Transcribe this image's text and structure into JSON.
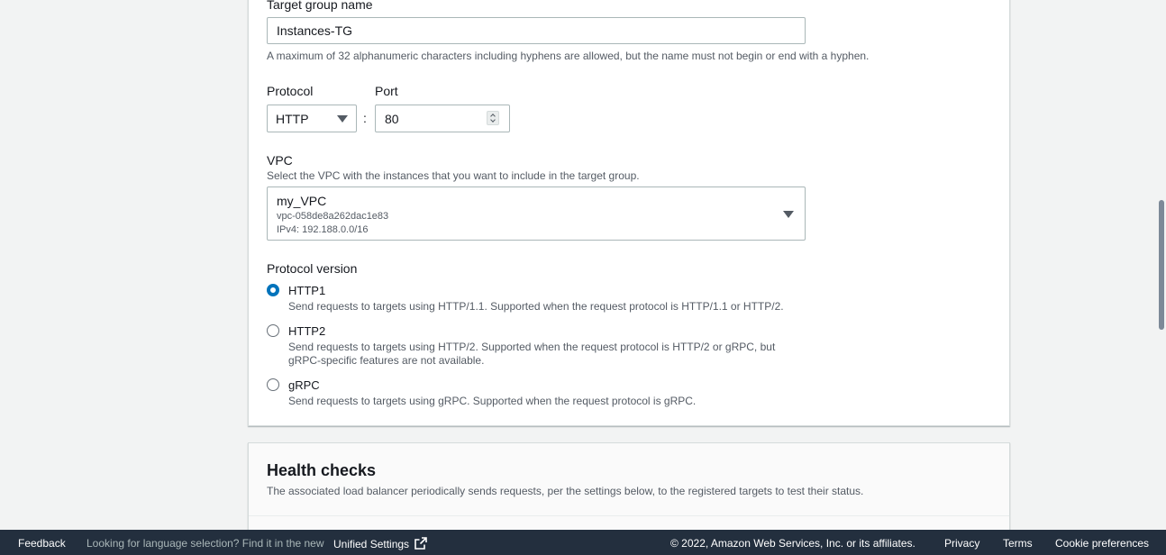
{
  "target_group": {
    "label": "Target group name",
    "value": "Instances-TG",
    "hint": "A maximum of 32 alphanumeric characters including hyphens are allowed, but the name must not begin or end with a hyphen."
  },
  "protocol": {
    "label": "Protocol",
    "value": "HTTP"
  },
  "separator": ":",
  "port": {
    "label": "Port",
    "value": "80"
  },
  "vpc": {
    "label": "VPC",
    "hint": "Select the VPC with the instances that you want to include in the target group.",
    "name": "my_VPC",
    "id": "vpc-058de8a262dac1e83",
    "cidr": "IPv4: 192.188.0.0/16"
  },
  "protocol_version": {
    "label": "Protocol version",
    "selected": "HTTP1",
    "options": [
      {
        "label": "HTTP1",
        "desc": "Send requests to targets using HTTP/1.1. Supported when the request protocol is HTTP/1.1 or HTTP/2."
      },
      {
        "label": "HTTP2",
        "desc": "Send requests to targets using HTTP/2. Supported when the request protocol is HTTP/2 or gRPC, but gRPC-specific features are not available."
      },
      {
        "label": "gRPC",
        "desc": "Send requests to targets using gRPC. Supported when the request protocol is gRPC."
      }
    ]
  },
  "health_checks": {
    "title": "Health checks",
    "desc": "The associated load balancer periodically sends requests, per the settings below, to the registered targets to test their status."
  },
  "footer": {
    "feedback": "Feedback",
    "language_prompt": "Looking for language selection? Find it in the new",
    "unified_settings": "Unified Settings",
    "copyright": "© 2022, Amazon Web Services, Inc. or its affiliates.",
    "privacy": "Privacy",
    "terms": "Terms",
    "cookie": "Cookie preferences"
  },
  "colors": {
    "accent": "#0073bb",
    "footer_bg": "#232f3e",
    "page_bg": "#f2f3f3"
  },
  "icons": [
    "caret-down-icon",
    "spinner-up-icon",
    "spinner-down-icon",
    "external-link-icon"
  ]
}
